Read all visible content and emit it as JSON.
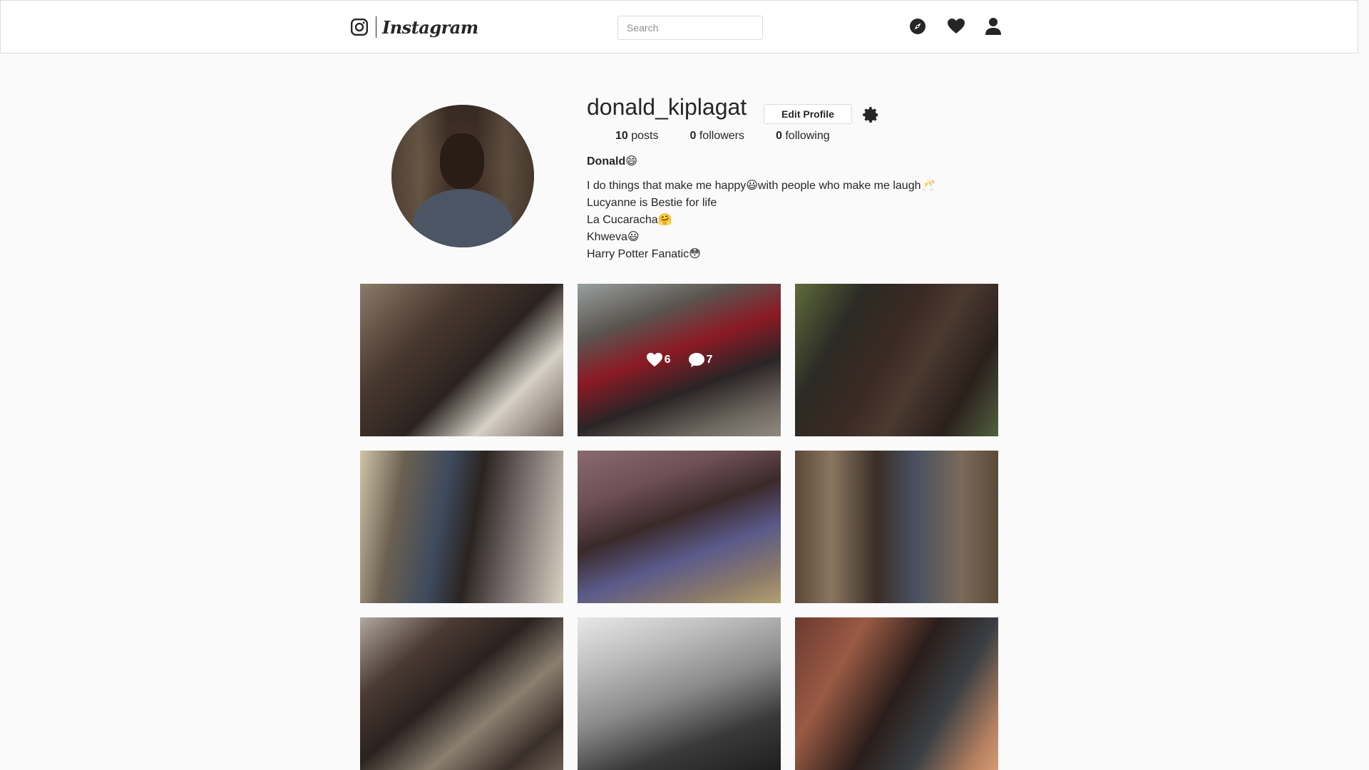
{
  "nav": {
    "brand": "Instagram",
    "search_placeholder": "Search",
    "icons": [
      "camera-icon",
      "compass-icon",
      "heart-icon",
      "person-icon"
    ]
  },
  "profile": {
    "username": "donald_kiplagat",
    "edit_label": "Edit Profile",
    "posts_count": "10",
    "posts_label": "posts",
    "followers_count": "0",
    "followers_label": "followers",
    "following_count": "0",
    "following_label": "following",
    "full_name": "Donald😄",
    "bio": [
      "I do things that make me happy😃with people who make me laugh🥂",
      "Lucyanne is Bestie for life",
      "La Cucaracha🤗",
      "Khweva😃",
      "Harry Potter Fanatic😳"
    ]
  },
  "posts": [
    {
      "likes": null,
      "comments": null
    },
    {
      "likes": "6",
      "comments": "7"
    },
    {
      "likes": null,
      "comments": null
    },
    {
      "likes": null,
      "comments": null
    },
    {
      "likes": null,
      "comments": null
    },
    {
      "likes": null,
      "comments": null
    },
    {
      "likes": null,
      "comments": null
    },
    {
      "likes": null,
      "comments": null
    },
    {
      "likes": null,
      "comments": null
    }
  ],
  "colors": {
    "background": "#fafafa",
    "border": "#dbdbdb",
    "text": "#262626"
  }
}
